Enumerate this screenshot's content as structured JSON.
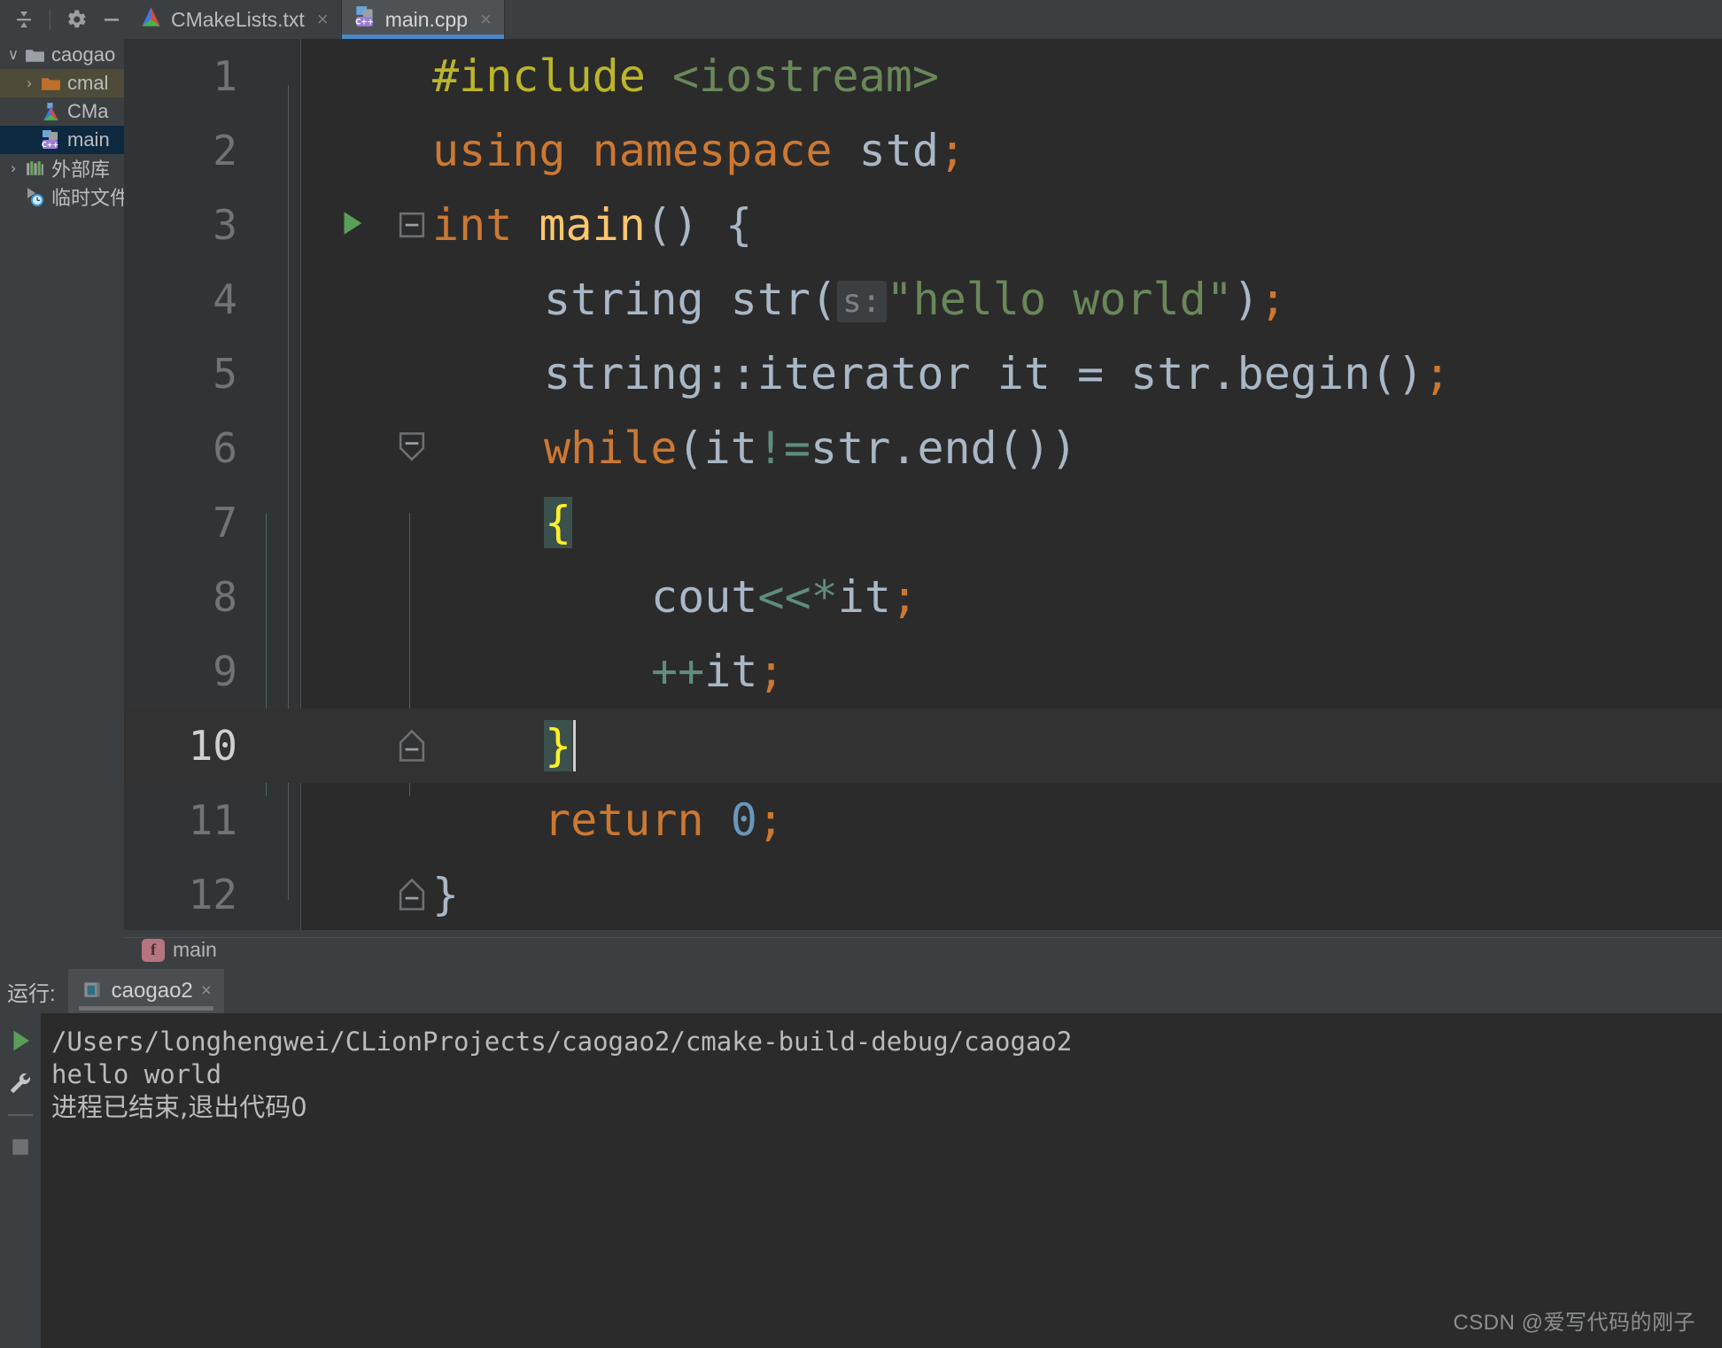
{
  "toolbar": {
    "collapse_all_icon": "collapse-all-icon",
    "settings_icon": "gear-icon",
    "minimize_icon": "minimize-icon"
  },
  "tabs": [
    {
      "label": "CMakeLists.txt",
      "icon": "cmake-icon",
      "active": false,
      "close": "×"
    },
    {
      "label": "main.cpp",
      "icon": "cpp-file-icon",
      "active": true,
      "close": "×"
    }
  ],
  "project_tree": [
    {
      "label": "caogao",
      "icon": "folder-icon",
      "indent": 0,
      "arrow": "∨",
      "state": "expanded"
    },
    {
      "label": "cmal",
      "icon": "folder-orange-icon",
      "indent": 1,
      "arrow": "›",
      "state": "selected-dir"
    },
    {
      "label": "CMa",
      "icon": "cmake-icon",
      "indent": 2,
      "arrow": "",
      "state": "none"
    },
    {
      "label": "main",
      "icon": "cpp-file-icon",
      "indent": 2,
      "arrow": "",
      "state": "selected-file"
    },
    {
      "label": "外部库",
      "icon": "library-icon",
      "indent": 0,
      "arrow": "›",
      "state": "none"
    },
    {
      "label": "临时文件",
      "icon": "scratch-icon",
      "indent": 0,
      "arrow": "",
      "state": "none"
    }
  ],
  "editor": {
    "current_line": 10,
    "caret_line": 10,
    "lines": [
      {
        "n": "1",
        "indent": 0
      },
      {
        "n": "2",
        "indent": 0
      },
      {
        "n": "3",
        "indent": 0,
        "run_marker": true,
        "fold": "minus"
      },
      {
        "n": "4",
        "indent": 1
      },
      {
        "n": "5",
        "indent": 1
      },
      {
        "n": "6",
        "indent": 1,
        "fold": "minus"
      },
      {
        "n": "7",
        "indent": 1
      },
      {
        "n": "8",
        "indent": 2
      },
      {
        "n": "9",
        "indent": 2
      },
      {
        "n": "10",
        "indent": 1,
        "fold": "end"
      },
      {
        "n": "11",
        "indent": 1
      },
      {
        "n": "12",
        "indent": 0,
        "fold": "end"
      }
    ],
    "code": {
      "l1_include": "#include",
      "l1_header": " <iostream>",
      "l2_using": "using namespace ",
      "l2_std": "std",
      "l2_semi": ";",
      "l3_int": "int ",
      "l3_main": "main",
      "l3_rest": "() {",
      "l4_type": "string str(",
      "l4_hint": "s:",
      "l4_str": "\"hello world\"",
      "l4_tail": ")",
      "l4_semi": ";",
      "l5_a": "string::iterator it = str.begin()",
      "l5_semi": ";",
      "l6_while": "while",
      "l6_a": "(it",
      "l6_neq": "!=",
      "l6_b": "str.end())",
      "l7_brace": "{",
      "l8_a": "cout",
      "l8_op": "<<*",
      "l8_b": "it",
      "l8_semi": ";",
      "l9_op": "++",
      "l9_b": "it",
      "l9_semi": ";",
      "l10_brace": "}",
      "l11_return": "return ",
      "l11_num": "0",
      "l11_semi": ";",
      "l12_brace": "}"
    }
  },
  "breadcrumb": {
    "icon": "function-icon",
    "icon_letter": "f",
    "label": "main"
  },
  "run_panel": {
    "title": "运行:",
    "tab_label": "caogao2",
    "tab_icon": "run-config-icon",
    "tab_close": "×",
    "gutter_icons": [
      "run-icon",
      "wrench-icon",
      "stop-icon"
    ],
    "console_lines": [
      "/Users/longhengwei/CLionProjects/caogao2/cmake-build-debug/caogao2",
      "hello world",
      "进程已结束,退出代码0"
    ]
  },
  "watermark": "CSDN @爱写代码的刚子",
  "colors": {
    "editor_bg": "#2b2b2b",
    "panel_bg": "#3c3f41",
    "keyword": "#cc7832",
    "string": "#6a8759",
    "directive": "#bbb529",
    "function": "#ffc66d",
    "number": "#6897bb",
    "default_text": "#a9b7c6",
    "brace_highlight_bg": "#3b514d",
    "brace_highlight_fg": "#ffef28",
    "tab_underline": "#4a88c7",
    "selection_file": "#0d2940",
    "selection_dir": "#4e4b38"
  }
}
